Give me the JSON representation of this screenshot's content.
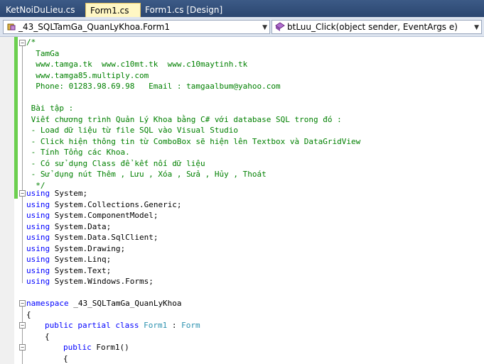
{
  "tabs": [
    {
      "label": "KetNoiDuLieu.cs",
      "active": false
    },
    {
      "label": "Form1.cs",
      "active": true
    },
    {
      "label": "Form1.cs [Design]",
      "active": false
    }
  ],
  "navbar": {
    "class_combo": "_43_SQLTamGa_QuanLyKhoa.Form1",
    "member_combo": "btLuu_Click(object sender, EventArgs e)"
  },
  "code": {
    "comment": [
      "/*",
      "  TamGa",
      "  www.tamga.tk  www.c10mt.tk  www.c10maytinh.tk",
      "  www.tamga85.multiply.com",
      "  Phone: 01283.98.69.98   Email : tamgaalbum@yahoo.com",
      "",
      " Bài tập :",
      " Viết chương trình Quản Lý Khoa bằng C# với database SQL trong đó :",
      " - Load dữ liệu từ file SQL vào Visual Studio",
      " - Click hiện thông tin từ ComboBox sẽ hiện lên Textbox và DataGridView",
      " - Tính Tổng các Khoa.",
      " - Có sử dụng Class để kết nối dữ liệu",
      " - Sử dụng nút Thêm , Lưu , Xóa , Sửa , Hủy , Thoát",
      "  */"
    ],
    "using_keyword": "using",
    "usings": [
      " System;",
      " System.Collections.Generic;",
      " System.ComponentModel;",
      " System.Data;",
      " System.Data.SqlClient;",
      " System.Drawing;",
      " System.Linq;",
      " System.Text;",
      " System.Windows.Forms;"
    ],
    "namespace_keyword": "namespace",
    "namespace_name": " _43_SQLTamGa_QuanLyKhoa",
    "open_brace": "{",
    "class_decl": {
      "kw1": "public",
      "kw2": " partial",
      "kw3": " class",
      "name": " Form1",
      "sep": " : ",
      "base": "Form"
    },
    "ctor_kw": "public",
    "ctor_rest": " Form1()"
  },
  "colors": {
    "keyword": "#0000ff",
    "type": "#2b91af",
    "comment": "#008000",
    "tab_strip": "#2b4670",
    "active_tab": "#fff7c4",
    "change_bar": "#6ccf4f"
  }
}
